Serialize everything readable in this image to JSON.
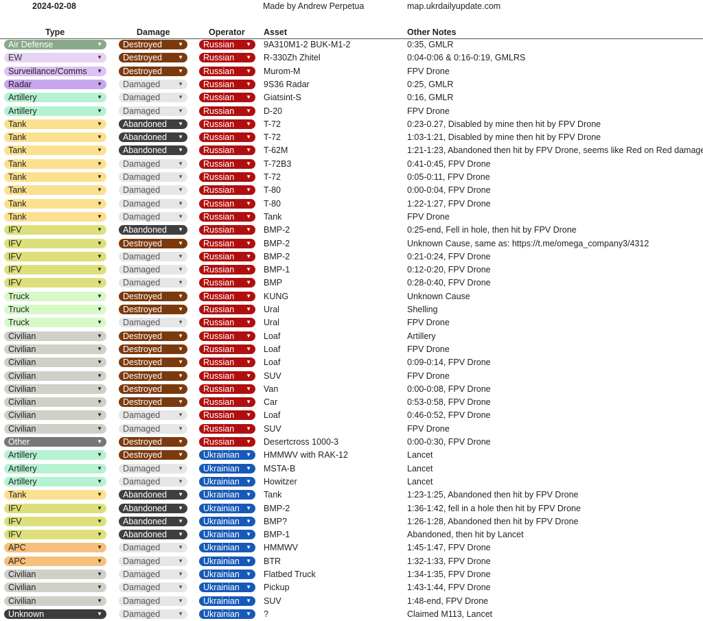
{
  "header": {
    "date": "2024-02-08",
    "author": "Made by Andrew Perpetua",
    "site": "map.ukrdailyupdate.com"
  },
  "columns": {
    "type": "Type",
    "damage": "Damage",
    "operator": "Operator",
    "asset": "Asset",
    "notes": "Other Notes"
  },
  "colors": {
    "type": {
      "Air Defense": {
        "bg": "#8aa88a",
        "fg": "#ffffff"
      },
      "EW": {
        "bg": "#e7d3f3",
        "fg": "#333333"
      },
      "Surveillance/Comms": {
        "bg": "#ddc0f4",
        "fg": "#222222"
      },
      "Radar": {
        "bg": "#c7a6ee",
        "fg": "#222222"
      },
      "Artillery": {
        "bg": "#b5f2d2",
        "fg": "#222222"
      },
      "Tank": {
        "bg": "#fbe08f",
        "fg": "#222222"
      },
      "IFV": {
        "bg": "#dde07a",
        "fg": "#222222"
      },
      "Truck": {
        "bg": "#d7f9c8",
        "fg": "#222222"
      },
      "Civilian": {
        "bg": "#cfd0c8",
        "fg": "#222222"
      },
      "Other": {
        "bg": "#777777",
        "fg": "#ffffff"
      },
      "APC": {
        "bg": "#f6bf7c",
        "fg": "#222222"
      },
      "Unknown": {
        "bg": "#3c3c3c",
        "fg": "#ffffff"
      }
    },
    "damage": {
      "Destroyed": {
        "bg": "#7b3a0e",
        "fg": "#ffffff"
      },
      "Damaged": {
        "bg": "#e6e6e6",
        "fg": "#555555"
      },
      "Abandoned": {
        "bg": "#3f3f3f",
        "fg": "#ffffff"
      }
    },
    "operator": {
      "Russian": {
        "bg": "#b10f0f",
        "fg": "#ffffff"
      },
      "Ukrainian": {
        "bg": "#1759b8",
        "fg": "#ffffff"
      }
    }
  },
  "rows": [
    {
      "type": "Air Defense",
      "damage": "Destroyed",
      "operator": "Russian",
      "asset": "9A310M1-2 BUK-M1-2",
      "notes": "0:35, GMLR"
    },
    {
      "type": "EW",
      "damage": "Destroyed",
      "operator": "Russian",
      "asset": "R-330Zh Zhitel",
      "notes": "0:04-0:06 & 0:16-0:19, GMLRS"
    },
    {
      "type": "Surveillance/Comms",
      "damage": "Destroyed",
      "operator": "Russian",
      "asset": "Murom-M",
      "notes": "FPV Drone"
    },
    {
      "type": "Radar",
      "damage": "Damaged",
      "operator": "Russian",
      "asset": "9S36 Radar",
      "notes": "0:25, GMLR"
    },
    {
      "type": "Artillery",
      "damage": "Damaged",
      "operator": "Russian",
      "asset": "Giatsint-S",
      "notes": "0:16, GMLR"
    },
    {
      "type": "Artillery",
      "damage": "Damaged",
      "operator": "Russian",
      "asset": "D-20",
      "notes": "FPV Drone"
    },
    {
      "type": "Tank",
      "damage": "Abandoned",
      "operator": "Russian",
      "asset": "T-72",
      "notes": "0:23-0.27, Disabled by mine then hit by FPV Drone"
    },
    {
      "type": "Tank",
      "damage": "Abandoned",
      "operator": "Russian",
      "asset": "T-72",
      "notes": "1:03-1:21, Disabled by mine then hit by FPV Drone"
    },
    {
      "type": "Tank",
      "damage": "Abandoned",
      "operator": "Russian",
      "asset": "T-62M",
      "notes": "1:21-1:23, Abandoned then hit by FPV Drone, seems like Red on Red damage"
    },
    {
      "type": "Tank",
      "damage": "Damaged",
      "operator": "Russian",
      "asset": "T-72B3",
      "notes": "0:41-0:45, FPV Drone"
    },
    {
      "type": "Tank",
      "damage": "Damaged",
      "operator": "Russian",
      "asset": "T-72",
      "notes": "0:05-0:11, FPV Drone"
    },
    {
      "type": "Tank",
      "damage": "Damaged",
      "operator": "Russian",
      "asset": "T-80",
      "notes": "0:00-0:04, FPV Drone"
    },
    {
      "type": "Tank",
      "damage": "Damaged",
      "operator": "Russian",
      "asset": "T-80",
      "notes": "1:22-1:27, FPV Drone"
    },
    {
      "type": "Tank",
      "damage": "Damaged",
      "operator": "Russian",
      "asset": "Tank",
      "notes": "FPV Drone"
    },
    {
      "type": "IFV",
      "damage": "Abandoned",
      "operator": "Russian",
      "asset": "BMP-2",
      "notes": "0:25-end, Fell in hole, then hit by FPV Drone"
    },
    {
      "type": "IFV",
      "damage": "Destroyed",
      "operator": "Russian",
      "asset": "BMP-2",
      "notes": "Unknown Cause, same as: https://t.me/omega_company3/4312"
    },
    {
      "type": "IFV",
      "damage": "Damaged",
      "operator": "Russian",
      "asset": "BMP-2",
      "notes": "0:21-0:24, FPV Drone"
    },
    {
      "type": "IFV",
      "damage": "Damaged",
      "operator": "Russian",
      "asset": "BMP-1",
      "notes": "0:12-0:20, FPV Drone"
    },
    {
      "type": "IFV",
      "damage": "Damaged",
      "operator": "Russian",
      "asset": "BMP",
      "notes": "0:28-0:40, FPV Drone"
    },
    {
      "type": "Truck",
      "damage": "Destroyed",
      "operator": "Russian",
      "asset": "KUNG",
      "notes": "Unknown Cause"
    },
    {
      "type": "Truck",
      "damage": "Destroyed",
      "operator": "Russian",
      "asset": "Ural",
      "notes": "Shelling"
    },
    {
      "type": "Truck",
      "damage": "Damaged",
      "operator": "Russian",
      "asset": "Ural",
      "notes": "FPV Drone"
    },
    {
      "type": "Civilian",
      "damage": "Destroyed",
      "operator": "Russian",
      "asset": "Loaf",
      "notes": "Artillery"
    },
    {
      "type": "Civilian",
      "damage": "Destroyed",
      "operator": "Russian",
      "asset": "Loaf",
      "notes": "FPV Drone"
    },
    {
      "type": "Civilian",
      "damage": "Destroyed",
      "operator": "Russian",
      "asset": "Loaf",
      "notes": "0:09-0:14, FPV Drone"
    },
    {
      "type": "Civilian",
      "damage": "Destroyed",
      "operator": "Russian",
      "asset": "SUV",
      "notes": "FPV Drone"
    },
    {
      "type": "Civilian",
      "damage": "Destroyed",
      "operator": "Russian",
      "asset": "Van",
      "notes": "0:00-0:08, FPV Drone"
    },
    {
      "type": "Civilian",
      "damage": "Destroyed",
      "operator": "Russian",
      "asset": "Car",
      "notes": "0:53-0:58, FPV Drone"
    },
    {
      "type": "Civilian",
      "damage": "Damaged",
      "operator": "Russian",
      "asset": "Loaf",
      "notes": "0:46-0:52, FPV Drone"
    },
    {
      "type": "Civilian",
      "damage": "Damaged",
      "operator": "Russian",
      "asset": "SUV",
      "notes": "FPV Drone"
    },
    {
      "type": "Other",
      "damage": "Destroyed",
      "operator": "Russian",
      "asset": "Desertcross 1000-3",
      "notes": "0:00-0:30, FPV Drone"
    },
    {
      "type": "Artillery",
      "damage": "Destroyed",
      "operator": "Ukrainian",
      "asset": "HMMWV with RAK-12",
      "notes": "Lancet"
    },
    {
      "type": "Artillery",
      "damage": "Damaged",
      "operator": "Ukrainian",
      "asset": "MSTA-B",
      "notes": "Lancet"
    },
    {
      "type": "Artillery",
      "damage": "Damaged",
      "operator": "Ukrainian",
      "asset": "Howitzer",
      "notes": "Lancet"
    },
    {
      "type": "Tank",
      "damage": "Abandoned",
      "operator": "Ukrainian",
      "asset": "Tank",
      "notes": "1:23-1:25, Abandoned then hit by FPV Drone"
    },
    {
      "type": "IFV",
      "damage": "Abandoned",
      "operator": "Ukrainian",
      "asset": "BMP-2",
      "notes": "1:36-1:42, fell in a hole then hit by FPV Drone"
    },
    {
      "type": "IFV",
      "damage": "Abandoned",
      "operator": "Ukrainian",
      "asset": "BMP?",
      "notes": "1:26-1:28, Abandoned then hit by FPV Drone"
    },
    {
      "type": "IFV",
      "damage": "Abandoned",
      "operator": "Ukrainian",
      "asset": "BMP-1",
      "notes": "Abandoned, then hit by Lancet"
    },
    {
      "type": "APC",
      "damage": "Damaged",
      "operator": "Ukrainian",
      "asset": "HMMWV",
      "notes": "1:45-1:47, FPV Drone"
    },
    {
      "type": "APC",
      "damage": "Damaged",
      "operator": "Ukrainian",
      "asset": "BTR",
      "notes": "1:32-1:33, FPV Drone"
    },
    {
      "type": "Civilian",
      "damage": "Damaged",
      "operator": "Ukrainian",
      "asset": "Flatbed Truck",
      "notes": "1:34-1:35, FPV Drone"
    },
    {
      "type": "Civilian",
      "damage": "Damaged",
      "operator": "Ukrainian",
      "asset": "Pickup",
      "notes": "1:43-1:44, FPV Drone"
    },
    {
      "type": "Civilian",
      "damage": "Damaged",
      "operator": "Ukrainian",
      "asset": "SUV",
      "notes": "1:48-end, FPV Drone"
    },
    {
      "type": "Unknown",
      "damage": "Damaged",
      "operator": "Ukrainian",
      "asset": "?",
      "notes": "Claimed M113, Lancet"
    }
  ]
}
